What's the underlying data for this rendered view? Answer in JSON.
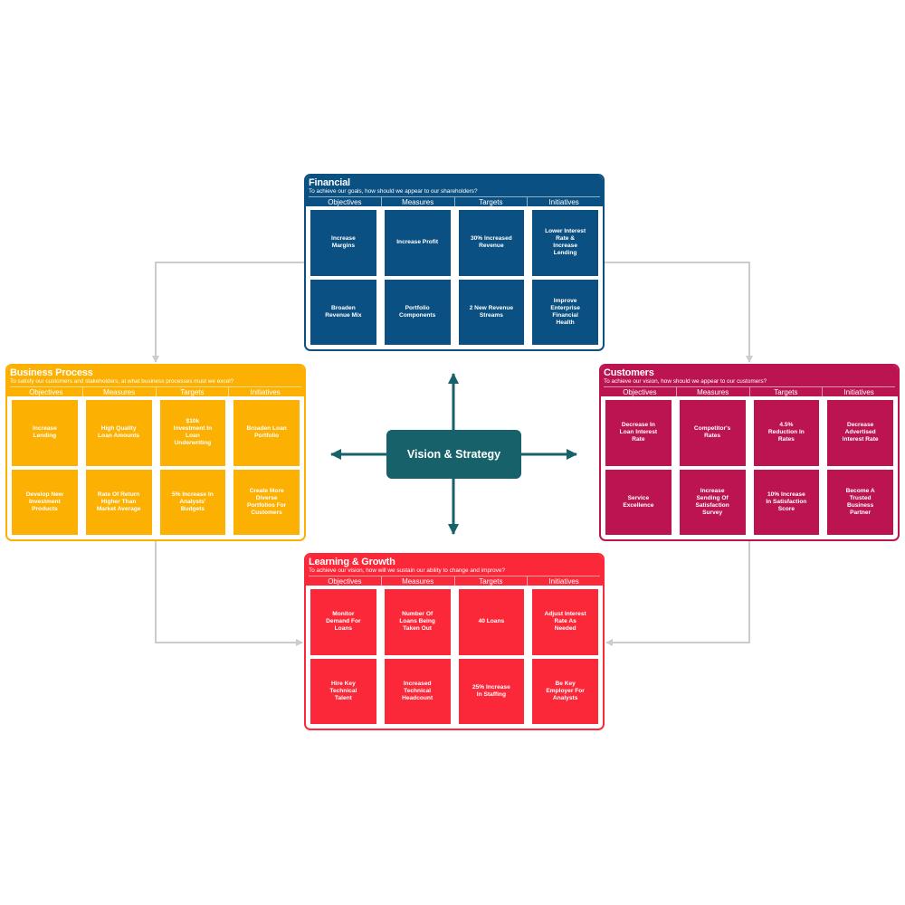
{
  "colors": {
    "financial": "#0b5082",
    "business_process": "#fbb002",
    "customers": "#bb1450",
    "learning_growth": "#fb2839",
    "vision": "#17626a",
    "connector": "#cccccc"
  },
  "vision": {
    "label": "Vision & Strategy"
  },
  "columns": [
    "Objectives",
    "Measures",
    "Targets",
    "Initiatives"
  ],
  "panels": {
    "financial": {
      "title": "Financial",
      "subtitle": "To achieve our goals, how should we appear to our shareholders?",
      "rows": [
        [
          "Increase Margins",
          "Increase Profit",
          "30% Increased Revenue",
          "Lower Interest Rate & Increase Lending"
        ],
        [
          "Broaden Revenue Mix",
          "Portfolio Components",
          "2 New Revenue Streams",
          "Improve Enterprise Financial Health"
        ]
      ]
    },
    "business_process": {
      "title": "Business Process",
      "subtitle": "To satisfy our customers and stakeholders, at what business processes must we excel?",
      "rows": [
        [
          "Increase Lending",
          "High Quality Loan Amounts",
          "$10k Investment In Loan Underwriting",
          "Broaden Loan Portfolio"
        ],
        [
          "Develop New Investment Products",
          "Rate Of Return Higher Than Market Average",
          "5% Increase In Analysts' Budgets",
          "Create More Diverse Portfolios For Customers"
        ]
      ]
    },
    "customers": {
      "title": "Customers",
      "subtitle": "To achieve our vision, how should we appear to our customers?",
      "rows": [
        [
          "Decrease In Loan Interest Rate",
          "Competitor's Rates",
          "4.5% Reduction In Rates",
          "Decrease Advertised Interest Rate"
        ],
        [
          "Service Excellence",
          "Increase Sending Of Satisfaction Survey",
          "10% Increase In Satisfaction Score",
          "Become A Trusted Business Partner"
        ]
      ]
    },
    "learning_growth": {
      "title": "Learning & Growth",
      "subtitle": "To achieve our vision, how will we sustain our ability to change and improve?",
      "rows": [
        [
          "Monitor Demand For Loans",
          "Number Of Loans Being Taken Out",
          "40 Loans",
          "Adjust Interest Rate As Needed"
        ],
        [
          "Hire Key Technical Talent",
          "Increased Technical Headcount",
          "25% Increase In Staffing",
          "Be Key Employer For Analysts"
        ]
      ]
    }
  }
}
